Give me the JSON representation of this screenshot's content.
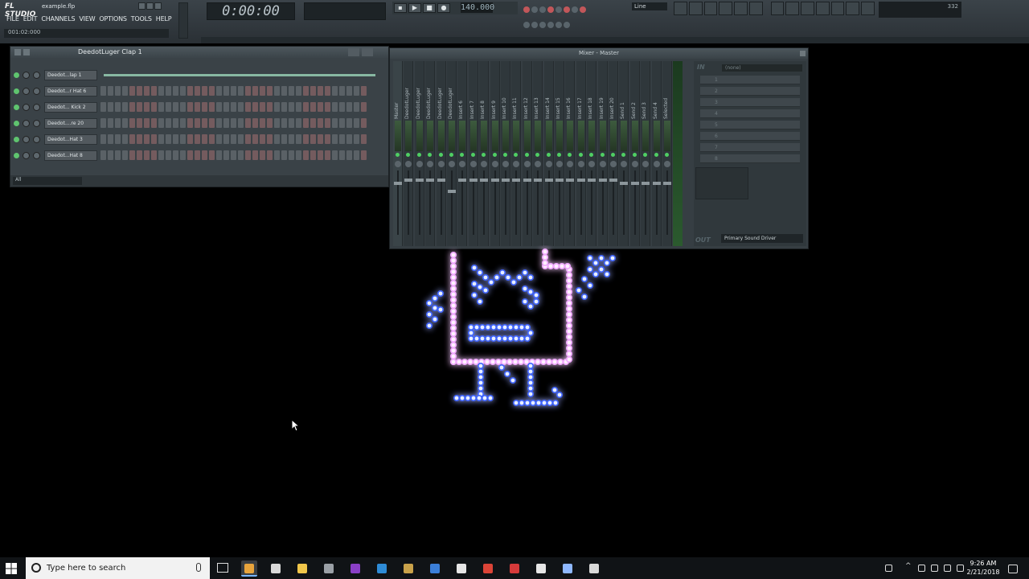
{
  "app": {
    "logo": "FL STUDIO",
    "project_file": "example.flp",
    "menu": [
      "FILE",
      "EDIT",
      "CHANNELS",
      "VIEW",
      "OPTIONS",
      "TOOLS",
      "HELP"
    ],
    "hint": "001:02:000",
    "time": "0:00:00",
    "bpm": "140.000",
    "line_mode": "Line",
    "cpu_readout": "332"
  },
  "channel_rack": {
    "title": "DeedotLuger Clap 1",
    "footer_filter": "All",
    "channels": [
      {
        "name": "Deedot...lap 1",
        "mode": "graph"
      },
      {
        "name": "Deedot...r Hat 6",
        "mode": "steps"
      },
      {
        "name": "Deedot... Kick 2",
        "mode": "steps"
      },
      {
        "name": "Deedot....re 20",
        "mode": "steps"
      },
      {
        "name": "Deedot...Hat 3",
        "mode": "steps"
      },
      {
        "name": "Deedot...Hat 8",
        "mode": "steps"
      }
    ]
  },
  "mixer": {
    "title": "Mixer - Master",
    "insert_slot_label": "(none)",
    "output_label": "OUT",
    "output_driver": "Primary Sound Driver",
    "strips": [
      "Master",
      "DeedotLuger",
      "DeedotLuger",
      "DeedotLuger",
      "DeedotLuger",
      "DeedotLuger",
      "Insert 6",
      "Insert 7",
      "Insert 8",
      "Insert 9",
      "Insert 10",
      "Insert 11",
      "Insert 12",
      "Insert 13",
      "Insert 14",
      "Insert 15",
      "Insert 16",
      "Insert 17",
      "Insert 18",
      "Insert 19",
      "Insert 20",
      "Send 1",
      "Send 2",
      "Send 3",
      "Send 4",
      "Selected"
    ],
    "slots": [
      "1",
      "2",
      "3",
      "4",
      "5",
      "6",
      "7",
      "8"
    ]
  },
  "taskbar": {
    "search_placeholder": "Type here to search",
    "time": "9:26 AM",
    "date": "2/21/2018",
    "icons": [
      "fl-studio-icon",
      "store-icon",
      "file-explorer-icon",
      "media-icon",
      "premiere-icon",
      "photoshop-icon",
      "folder-icon",
      "search-app-icon",
      "unity-icon",
      "chrome-icon",
      "red-app-icon",
      "file-icon",
      "fl-logo-icon",
      "settings-icon"
    ]
  },
  "colors": {
    "mascot_body": "#3d63ff",
    "mascot_outline": "#f0a8ff",
    "accent_green": "#4fcf63",
    "taskbar": "#101316"
  }
}
